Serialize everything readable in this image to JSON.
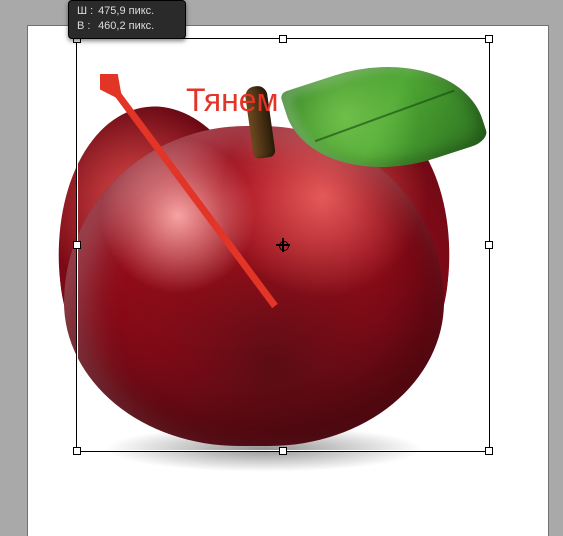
{
  "tooltip": {
    "width_key": "Ш :",
    "width_value": "475,9 пикс.",
    "height_key": "В  :",
    "height_value": "460,2 пикс."
  },
  "annotation": {
    "label": "Тянем",
    "arrow_color": "#e33527"
  },
  "subject": {
    "name": "red-apple-with-leaf"
  }
}
